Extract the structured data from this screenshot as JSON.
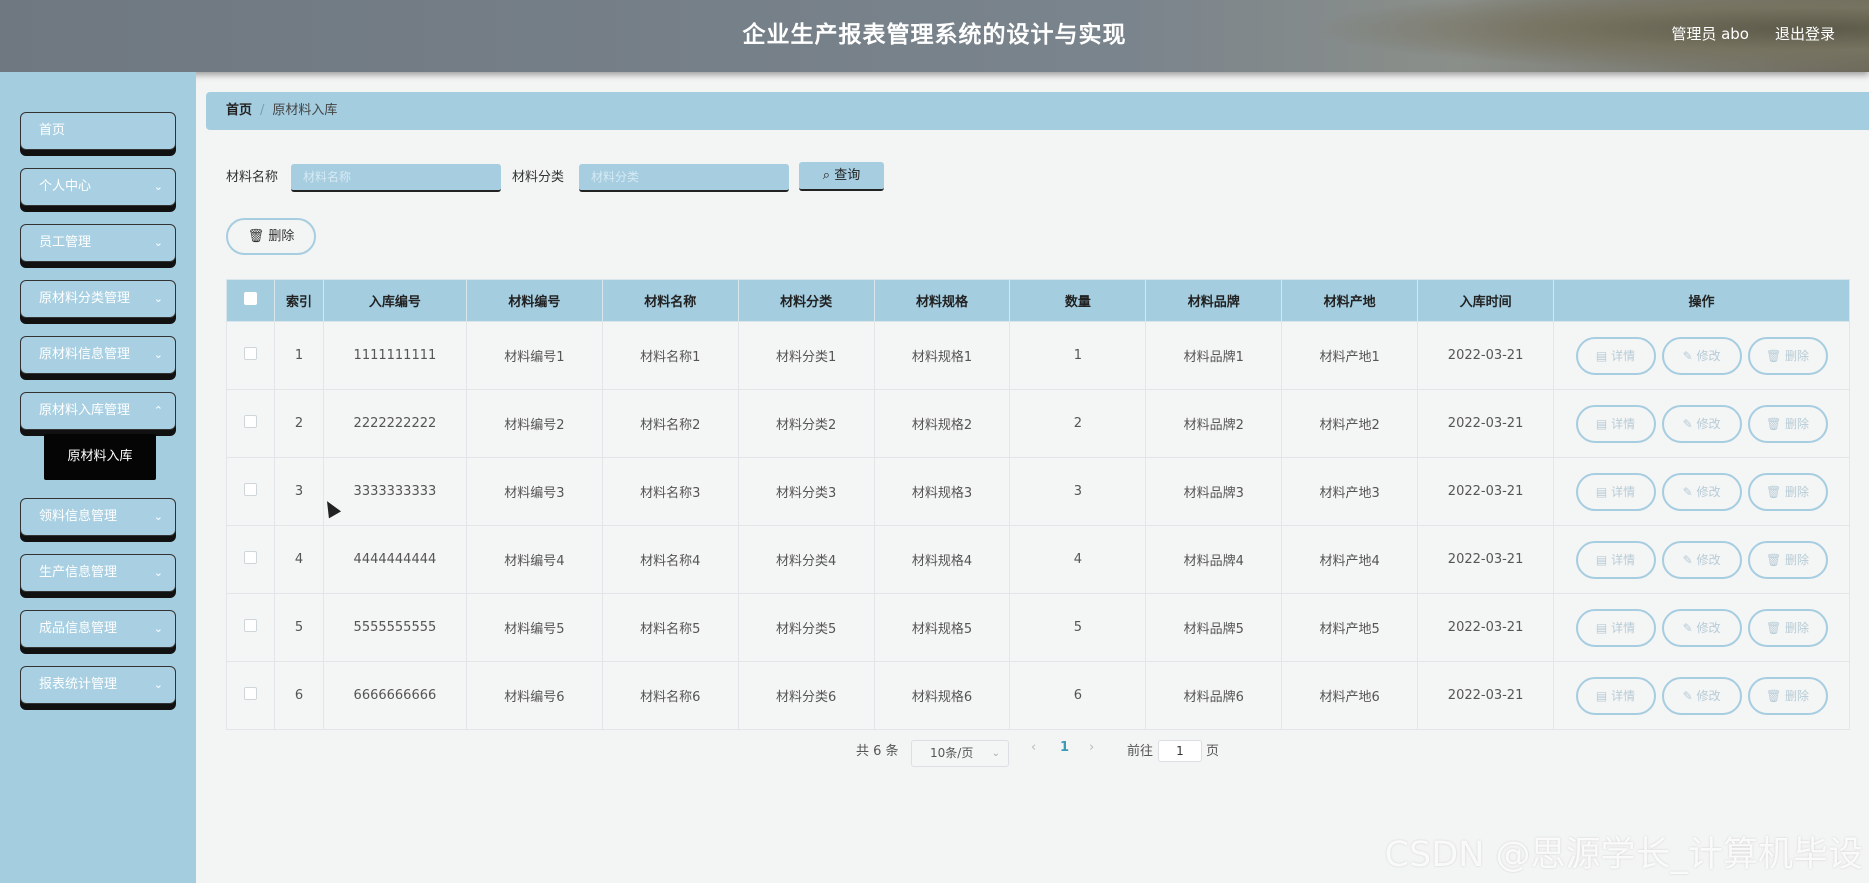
{
  "header": {
    "title": "企业生产报表管理系统的设计与实现",
    "user": "管理员 abo",
    "logout": "退出登录"
  },
  "sidebar": {
    "items": [
      {
        "label": "首页",
        "has_chevron": false
      },
      {
        "label": "个人中心",
        "has_chevron": true
      },
      {
        "label": "员工管理",
        "has_chevron": true
      },
      {
        "label": "原材料分类管理",
        "has_chevron": true
      },
      {
        "label": "原材料信息管理",
        "has_chevron": true
      },
      {
        "label": "原材料入库管理",
        "has_chevron": true
      },
      {
        "label": "领料信息管理",
        "has_chevron": true
      },
      {
        "label": "生产信息管理",
        "has_chevron": true
      },
      {
        "label": "成品信息管理",
        "has_chevron": true
      },
      {
        "label": "报表统计管理",
        "has_chevron": true
      }
    ],
    "sub_item": "原材料入库"
  },
  "breadcrumb": {
    "home": "首页",
    "sep": "/",
    "current": "原材料入库"
  },
  "search": {
    "name_label": "材料名称",
    "name_placeholder": "材料名称",
    "category_label": "材料分类",
    "category_placeholder": "材料分类",
    "query_button": "查询"
  },
  "actions": {
    "delete_button": "删除"
  },
  "table": {
    "headers": [
      "索引",
      "入库编号",
      "材料编号",
      "材料名称",
      "材料分类",
      "材料规格",
      "数量",
      "材料品牌",
      "材料产地",
      "入库时间",
      "操作"
    ],
    "rows": [
      [
        "1",
        "1111111111",
        "材料编号1",
        "材料名称1",
        "材料分类1",
        "材料规格1",
        "1",
        "材料品牌1",
        "材料产地1",
        "2022-03-21"
      ],
      [
        "2",
        "2222222222",
        "材料编号2",
        "材料名称2",
        "材料分类2",
        "材料规格2",
        "2",
        "材料品牌2",
        "材料产地2",
        "2022-03-21"
      ],
      [
        "3",
        "3333333333",
        "材料编号3",
        "材料名称3",
        "材料分类3",
        "材料规格3",
        "3",
        "材料品牌3",
        "材料产地3",
        "2022-03-21"
      ],
      [
        "4",
        "4444444444",
        "材料编号4",
        "材料名称4",
        "材料分类4",
        "材料规格4",
        "4",
        "材料品牌4",
        "材料产地4",
        "2022-03-21"
      ],
      [
        "5",
        "5555555555",
        "材料编号5",
        "材料名称5",
        "材料分类5",
        "材料规格5",
        "5",
        "材料品牌5",
        "材料产地5",
        "2022-03-21"
      ],
      [
        "6",
        "6666666666",
        "材料编号6",
        "材料名称6",
        "材料分类6",
        "材料规格6",
        "6",
        "材料品牌6",
        "材料产地6",
        "2022-03-21"
      ]
    ],
    "op_labels": [
      "详情",
      "修改",
      "删除"
    ]
  },
  "pagination": {
    "total": "共 6 条",
    "page_size": "10条/页",
    "prev": "‹",
    "current": "1",
    "next": "›",
    "goto_label": "前往",
    "goto_value": "1",
    "page_suffix": "页"
  },
  "watermark": "CSDN @思源学长_计算机毕设",
  "colors": {
    "accent": "#a4cde0",
    "header": "#767f87",
    "active_sub": "#050505"
  }
}
